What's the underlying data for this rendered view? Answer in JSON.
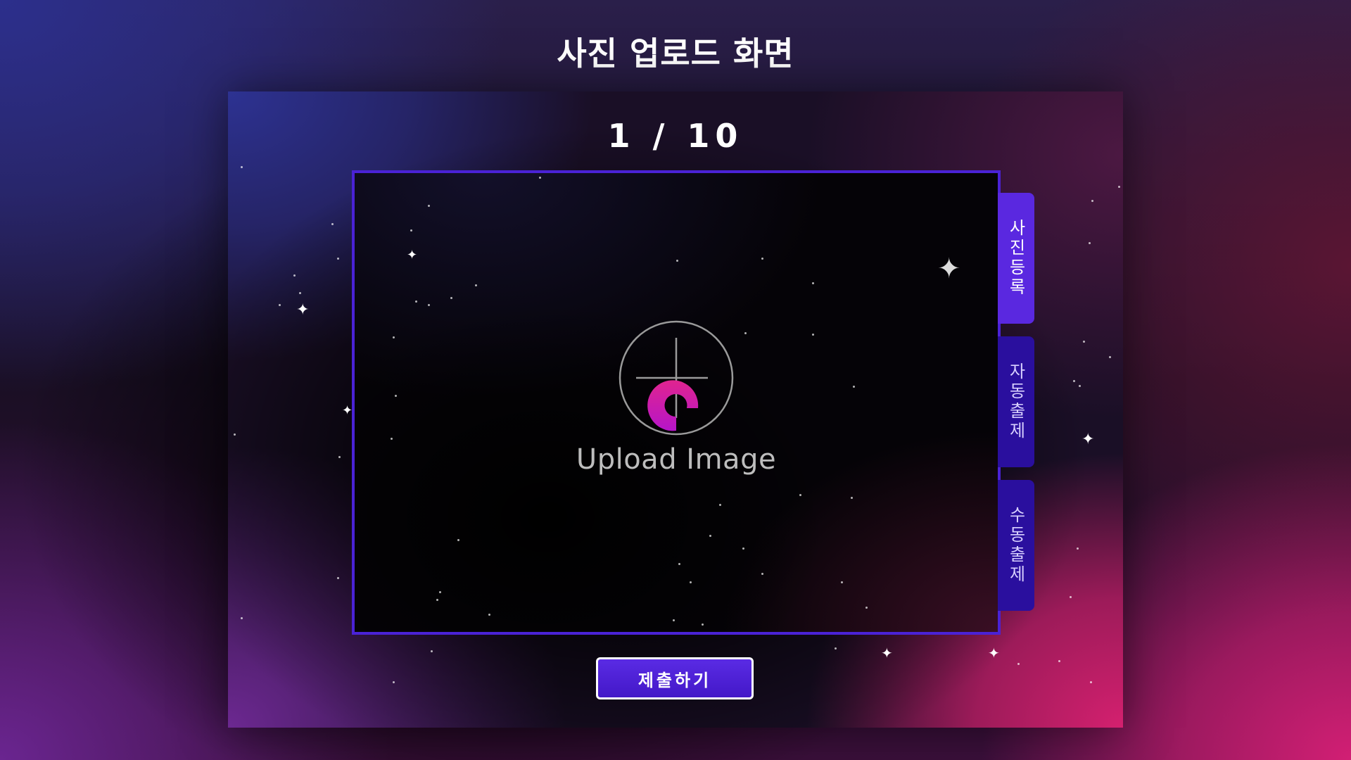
{
  "header": {
    "title": "사진 업로드 화면"
  },
  "progress": {
    "current": 1,
    "total": 10,
    "text": "1 / 10"
  },
  "upload_area": {
    "label": "Upload Image",
    "icon": "upload-plus-icon",
    "logo_colors": [
      "#e0248f",
      "#b615c9"
    ]
  },
  "side_tabs": [
    {
      "label": "사진등록",
      "active": true
    },
    {
      "label": "자동출제",
      "active": false
    },
    {
      "label": "수동출제",
      "active": false
    }
  ],
  "actions": {
    "submit_label": "제출하기"
  },
  "colors": {
    "accent": "#4a22d6",
    "tab_active": "#5a28e0",
    "tab_inactive": "#2a0f9e",
    "button": "#4f22d8"
  }
}
